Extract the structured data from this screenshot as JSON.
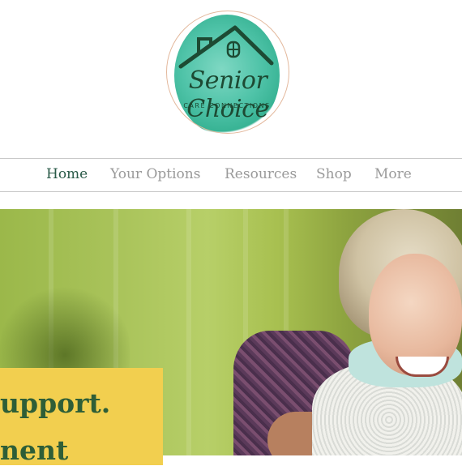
{
  "logo": {
    "script_text": "Senior Choice",
    "subtitle": "CARE CONNECTIONS"
  },
  "nav": {
    "items": [
      {
        "label": "Home",
        "active": true
      },
      {
        "label": "Your Options",
        "active": false
      },
      {
        "label": "Resources",
        "active": false
      },
      {
        "label": "Shop",
        "active": false
      },
      {
        "label": "More",
        "active": false
      }
    ]
  },
  "hero": {
    "caption_line1": "upport.",
    "caption_line2": "nent"
  },
  "colors": {
    "nav_active": "#2a5a48",
    "nav_inactive": "#9a9a9a",
    "logo_teal": "#4fc3a8",
    "caption_bg": "#f2cf4f",
    "caption_text": "#2e5e37"
  }
}
